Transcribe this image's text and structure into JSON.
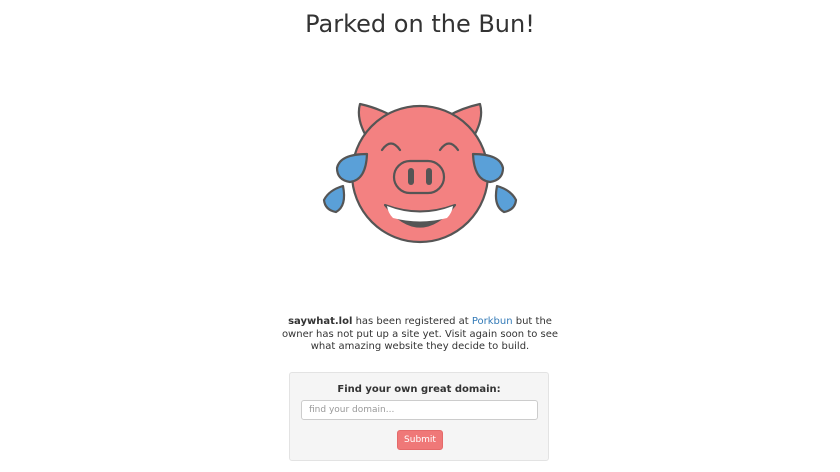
{
  "page": {
    "title": "Parked on the Bun!"
  },
  "message": {
    "domain": "saywhat.lol",
    "text_1": " has been registered at ",
    "registrar_link": "Porkbun",
    "text_2": " but the owner has not put up a site yet. Visit again soon to see what amazing website they decide to build."
  },
  "search": {
    "label": "Find your own great domain:",
    "placeholder": "find your domain...",
    "value": "",
    "submit_label": "Submit"
  },
  "colors": {
    "pig": "#f38181",
    "tears": "#5aa0d8",
    "outline": "#555555",
    "link": "#337ab7",
    "button": "#ef7878"
  },
  "icons": {
    "mascot": "laughing-pig-icon"
  }
}
